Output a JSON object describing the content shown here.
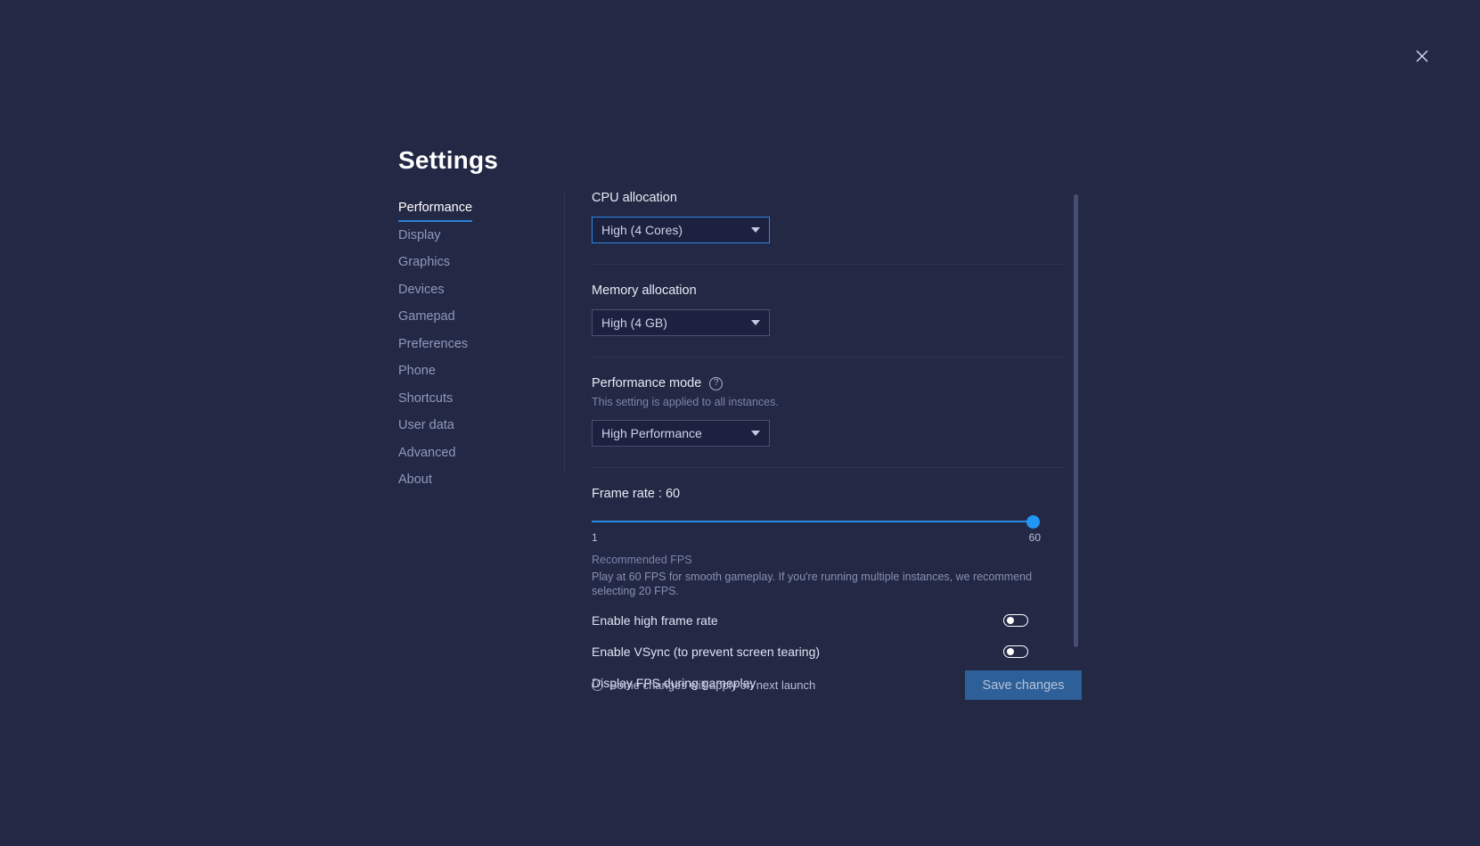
{
  "window": {
    "title": "Settings",
    "close_icon": "close-icon"
  },
  "sidebar": {
    "items": [
      {
        "label": "Performance",
        "active": true
      },
      {
        "label": "Display",
        "active": false
      },
      {
        "label": "Graphics",
        "active": false
      },
      {
        "label": "Devices",
        "active": false
      },
      {
        "label": "Gamepad",
        "active": false
      },
      {
        "label": "Preferences",
        "active": false
      },
      {
        "label": "Phone",
        "active": false
      },
      {
        "label": "Shortcuts",
        "active": false
      },
      {
        "label": "User data",
        "active": false
      },
      {
        "label": "Advanced",
        "active": false
      },
      {
        "label": "About",
        "active": false
      }
    ]
  },
  "content": {
    "cpu": {
      "label": "CPU allocation",
      "value": "High (4 Cores)",
      "focused": true
    },
    "memory": {
      "label": "Memory allocation",
      "value": "High (4 GB)",
      "focused": false
    },
    "performance_mode": {
      "label": "Performance mode",
      "help_icon": "?",
      "description": "This setting is applied to all instances.",
      "value": "High Performance",
      "focused": false
    },
    "frame_rate": {
      "label": "Frame rate : 60",
      "value": 60,
      "min_label": "1",
      "max_label": "60",
      "min": 1,
      "max": 60,
      "recommended_title": "Recommended FPS",
      "recommended_body": "Play at 60 FPS for smooth gameplay. If you're running multiple instances, we recommend selecting 20 FPS."
    },
    "toggles": [
      {
        "label": "Enable high frame rate",
        "on": false
      },
      {
        "label": "Enable VSync (to prevent screen tearing)",
        "on": false
      },
      {
        "label": "Display FPS during gameplay",
        "on": false
      }
    ]
  },
  "footer": {
    "info_icon": "i",
    "status_text": "Some changes will apply on next launch",
    "save_label": "Save changes"
  },
  "colors": {
    "background": "#232845",
    "accent": "#2b8ae6",
    "slider": "#2196f3",
    "save_button": "#2d6099"
  }
}
